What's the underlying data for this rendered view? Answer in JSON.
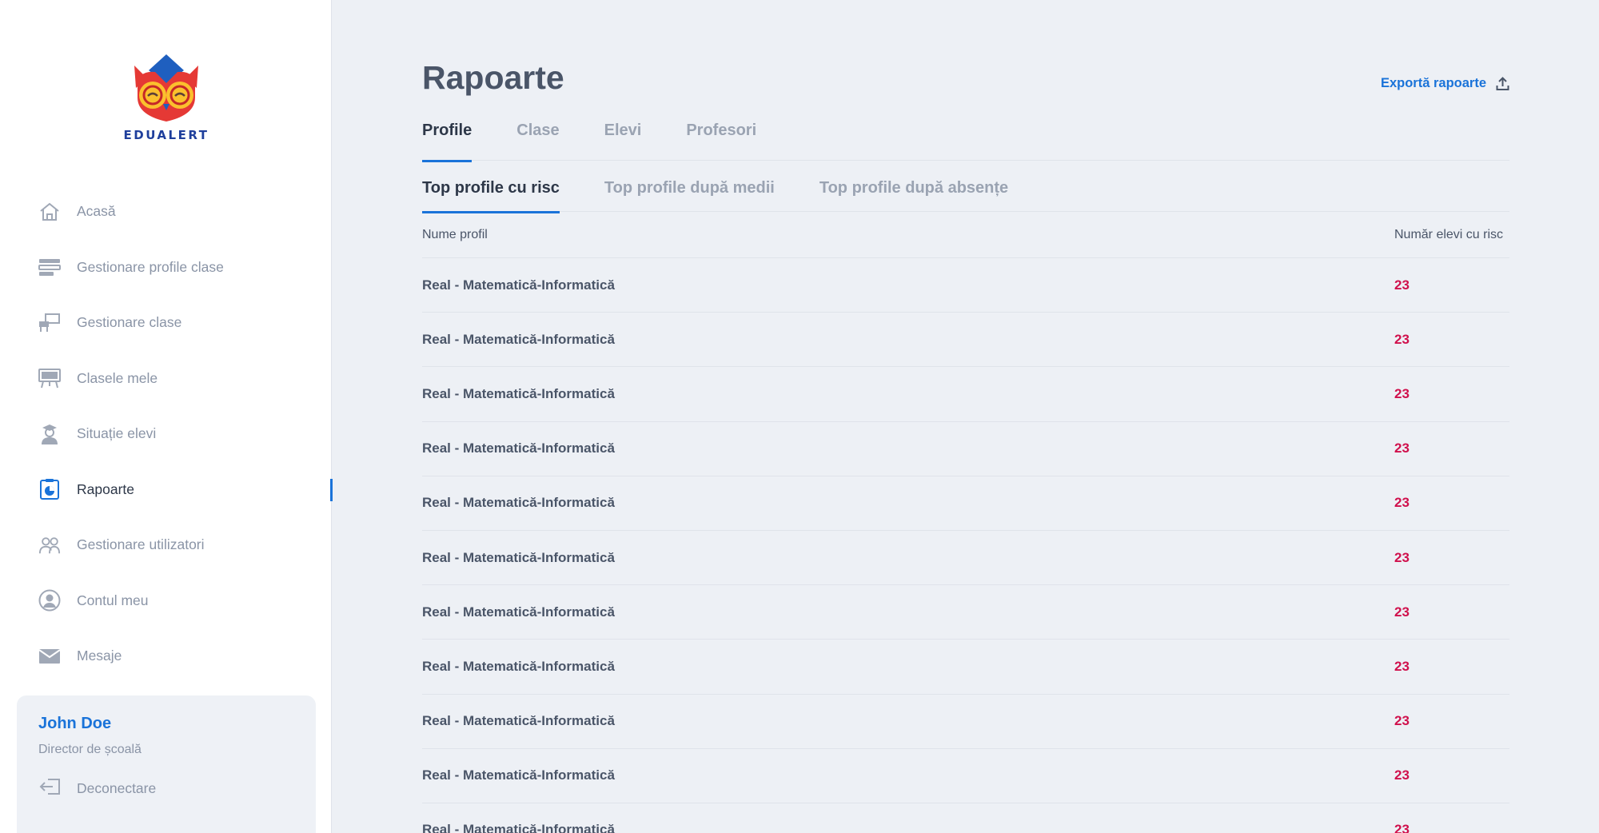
{
  "app": {
    "logo_text": "EDUALERT"
  },
  "sidebar": {
    "items": [
      {
        "label": "Acasă",
        "icon": "home-icon",
        "active": false
      },
      {
        "label": "Gestionare profile clase",
        "icon": "profiles-icon",
        "active": false
      },
      {
        "label": "Gestionare clase",
        "icon": "classroom-icon",
        "active": false
      },
      {
        "label": "Clasele mele",
        "icon": "board-icon",
        "active": false
      },
      {
        "label": "Situație elevi",
        "icon": "student-icon",
        "active": false
      },
      {
        "label": "Rapoarte",
        "icon": "reports-icon",
        "active": true
      },
      {
        "label": "Gestionare utilizatori",
        "icon": "users-icon",
        "active": false
      },
      {
        "label": "Contul meu",
        "icon": "account-icon",
        "active": false
      },
      {
        "label": "Mesaje",
        "icon": "mail-icon",
        "active": false
      }
    ]
  },
  "user": {
    "name": "John Doe",
    "role": "Director de școală",
    "logout_label": "Deconectare"
  },
  "page": {
    "title": "Rapoarte",
    "export_label": "Exportă rapoarte"
  },
  "tabs": [
    {
      "label": "Profile",
      "active": true
    },
    {
      "label": "Clase",
      "active": false
    },
    {
      "label": "Elevi",
      "active": false
    },
    {
      "label": "Profesori",
      "active": false
    }
  ],
  "subtabs": [
    {
      "label": "Top profile cu risc",
      "active": true
    },
    {
      "label": "Top profile după medii",
      "active": false
    },
    {
      "label": "Top profile după absențe",
      "active": false
    }
  ],
  "table": {
    "columns": [
      "Nume profil",
      "Număr elevi cu risc"
    ],
    "rows": [
      {
        "name": "Real - Matematică-Informatică",
        "count": "23"
      },
      {
        "name": "Real - Matematică-Informatică",
        "count": "23"
      },
      {
        "name": "Real - Matematică-Informatică",
        "count": "23"
      },
      {
        "name": "Real - Matematică-Informatică",
        "count": "23"
      },
      {
        "name": "Real - Matematică-Informatică",
        "count": "23"
      },
      {
        "name": "Real - Matematică-Informatică",
        "count": "23"
      },
      {
        "name": "Real - Matematică-Informatică",
        "count": "23"
      },
      {
        "name": "Real - Matematică-Informatică",
        "count": "23"
      },
      {
        "name": "Real - Matematică-Informatică",
        "count": "23"
      },
      {
        "name": "Real - Matematică-Informatică",
        "count": "23"
      },
      {
        "name": "Real - Matematică-Informatică",
        "count": "23"
      }
    ]
  },
  "colors": {
    "accent": "#1a73d9",
    "risk": "#d0104c",
    "background": "#edf0f5"
  }
}
